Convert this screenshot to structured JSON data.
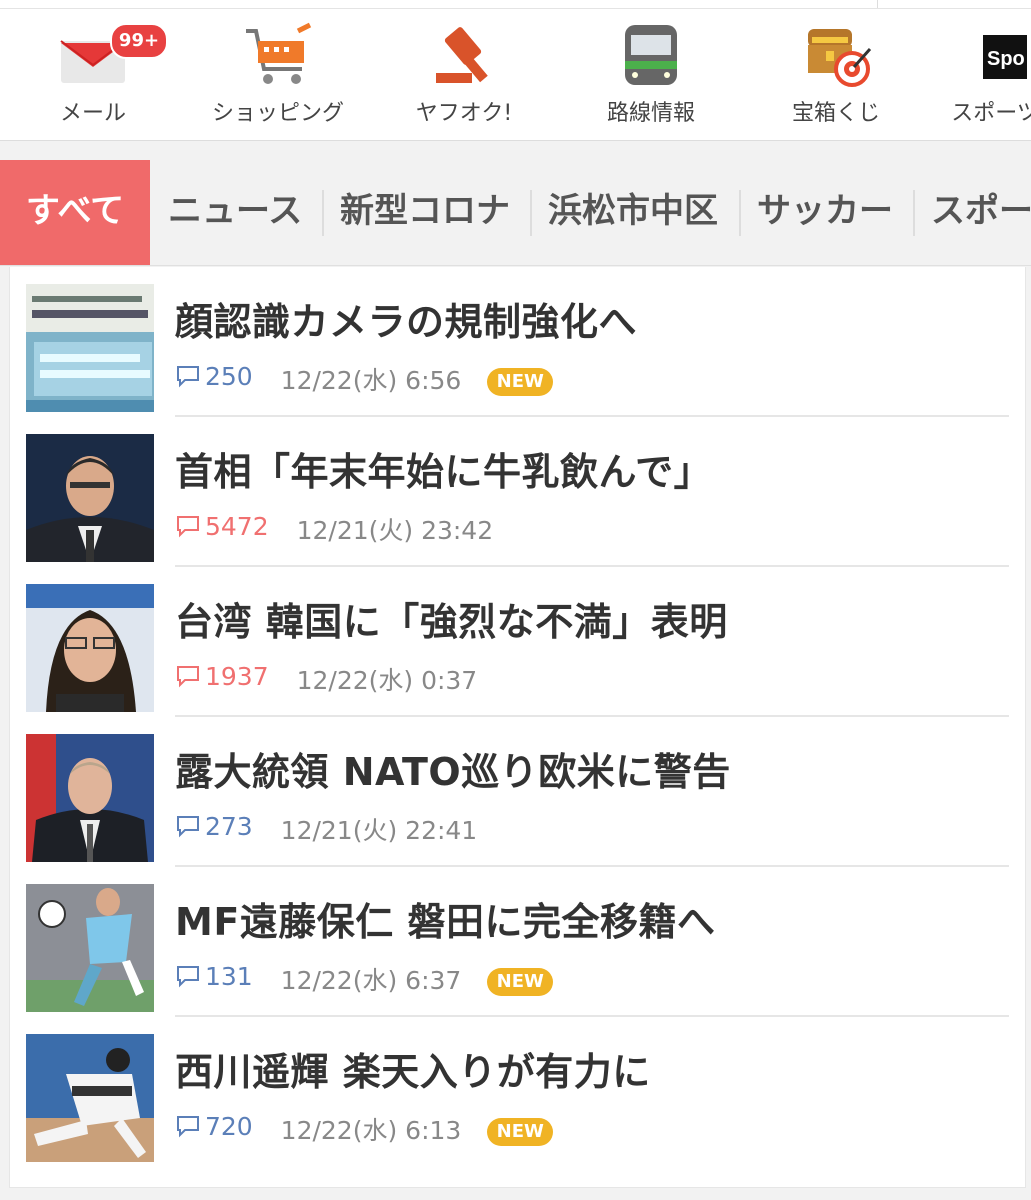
{
  "services": [
    {
      "label": "メール",
      "icon": "mail-icon",
      "badge": "99+"
    },
    {
      "label": "ショッピング",
      "icon": "shopping-cart-icon"
    },
    {
      "label": "ヤフオク!",
      "icon": "auction-gavel-icon"
    },
    {
      "label": "路線情報",
      "icon": "train-icon"
    },
    {
      "label": "宝箱くじ",
      "icon": "treasure-box-icon"
    },
    {
      "label": "スポーツ",
      "icon": "sports-navi-icon",
      "logo_text": "Spo"
    }
  ],
  "tabs": [
    {
      "label": "すべて",
      "active": true
    },
    {
      "label": "ニュース"
    },
    {
      "label": "新型コロナ"
    },
    {
      "label": "浜松市中区"
    },
    {
      "label": "サッカー"
    },
    {
      "label": "スポー"
    }
  ],
  "news": [
    {
      "title": "顔認識カメラの規制強化へ",
      "comments": "250",
      "date": "12/22(水) 6:56",
      "new": "NEW",
      "hot": false
    },
    {
      "title": "首相「年末年始に牛乳飲んで」",
      "comments": "5472",
      "date": "12/21(火) 23:42",
      "new": "",
      "hot": true
    },
    {
      "title": "台湾 韓国に「強烈な不満」表明",
      "comments": "1937",
      "date": "12/22(水) 0:37",
      "new": "",
      "hot": true
    },
    {
      "title": "露大統領 NATO巡り欧米に警告",
      "comments": "273",
      "date": "12/21(火) 22:41",
      "new": "",
      "hot": false
    },
    {
      "title": "MF遠藤保仁 磐田に完全移籍へ",
      "comments": "131",
      "date": "12/22(水) 6:37",
      "new": "NEW",
      "hot": false
    },
    {
      "title": "西川遥輝 楽天入りが有力に",
      "comments": "720",
      "date": "12/22(水) 6:13",
      "new": "NEW",
      "hot": false
    }
  ],
  "colors": {
    "accent_tab": "#f06a6a",
    "new_badge": "#f0b324",
    "comment_normal": "#5b7fb8",
    "comment_hot": "#f07070"
  }
}
